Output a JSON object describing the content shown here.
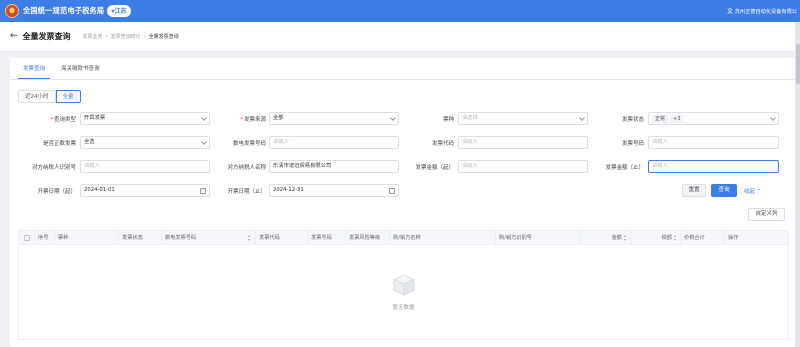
{
  "header": {
    "system_title": "全国统一规范电子税务局",
    "region": "江苏",
    "company": "苏州正德自动化设备有限公"
  },
  "page": {
    "back_icon": "arrow-left-icon",
    "title": "全量发票查询",
    "breadcrumb": [
      "发票业务",
      "发票查询统计",
      "全量发票查询"
    ]
  },
  "tabs": [
    {
      "label": "发票查询",
      "active": true
    },
    {
      "label": "海关缴款书查询",
      "active": false
    }
  ],
  "time_filter": {
    "options": [
      "近24小时",
      "全量"
    ],
    "selected": "全量"
  },
  "form": {
    "query_type": {
      "label": "查询类型",
      "value": "开具发票"
    },
    "invoice_source": {
      "label": "发票来源",
      "value": "全部"
    },
    "invoice_category": {
      "label": "票种",
      "placeholder": "请选择"
    },
    "invoice_status": {
      "label": "发票状态",
      "chip": "正常",
      "more": "+3"
    },
    "is_official": {
      "label": "是否正数发票",
      "value": "全选"
    },
    "digital_invoice_no": {
      "label": "数电发票号码",
      "placeholder": "请输入"
    },
    "invoice_code": {
      "label": "发票代码",
      "placeholder": "请输入"
    },
    "invoice_no": {
      "label": "发票号码",
      "placeholder": "请输入"
    },
    "buyer_tax_id": {
      "label": "对方纳税人识别号",
      "placeholder": "请输入"
    },
    "buyer_name": {
      "label": "对方纳税人名称",
      "value": "乐清市道迈贸易有限公司"
    },
    "amount_from": {
      "label": "发票金额（起）",
      "placeholder": "请输入"
    },
    "amount_to": {
      "label": "发票金额（止）",
      "placeholder": "请输入"
    },
    "date_from": {
      "label": "开票日期（起）",
      "value": "2024-01-01"
    },
    "date_to": {
      "label": "开票日期（止）",
      "value": "2024-12-31"
    }
  },
  "actions": {
    "reset": "重置",
    "query": "查询",
    "collapse": "收起",
    "customize": "自定义列"
  },
  "table": {
    "columns": [
      "序号",
      "票种",
      "发票状态",
      "数电发票号码",
      "发票代码",
      "发票号码",
      "发票风险等级",
      "购/销方名称",
      "购/销方识别号",
      "金额",
      "税额",
      "价税合计",
      "操作"
    ],
    "empty_text": "暂无数据"
  },
  "colors": {
    "primary": "#3c7ee6",
    "header_bg": "#3c7ee6",
    "page_bg": "#eef0f4"
  }
}
